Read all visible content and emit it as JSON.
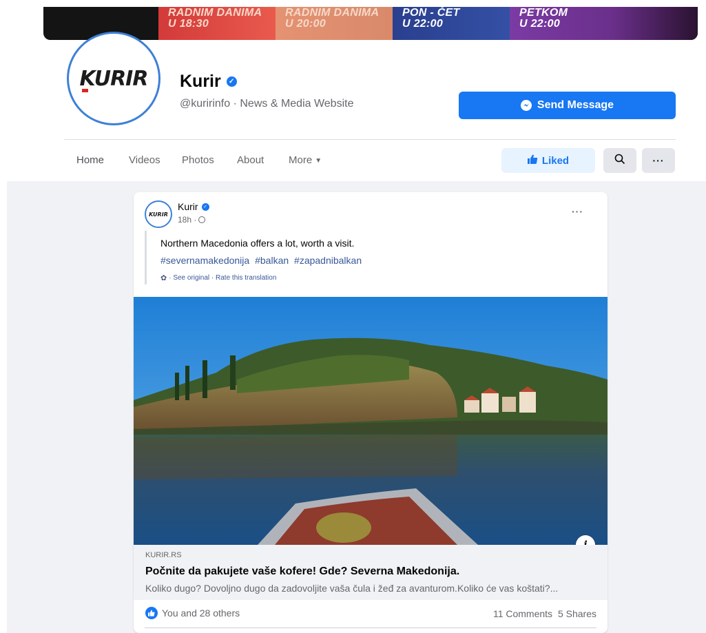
{
  "cover": {
    "segments": [
      {
        "line1": "RADNIM DANIMA",
        "line2": "U 18:30"
      },
      {
        "line1": "RADNIM DANIMA",
        "line2": "U 20:00"
      },
      {
        "line1": "PON - ČET",
        "line2": "U 22:00"
      },
      {
        "line1": "PETKOM",
        "line2": "U 22:00"
      }
    ]
  },
  "profile": {
    "avatar_logo": "KURIR",
    "name": "Kurir",
    "subtitle": "@kuririnfo · News & Media Website",
    "message_button": "Send Message"
  },
  "tabs": {
    "home": "Home",
    "videos": "Videos",
    "photos": "Photos",
    "about": "About",
    "more": "More",
    "liked": "Liked"
  },
  "post": {
    "avatar_logo": "KURIR",
    "author": "Kurir",
    "time": "18h ·",
    "text": "Northern Macedonia offers a lot, worth a visit.",
    "hashtags": [
      "#severnamakedonija",
      "#balkan",
      "#zapadnibalkan"
    ],
    "translation_meta": "· See original · Rate this translation",
    "link": {
      "domain": "KURIR.RS",
      "title": "Počnite da pakujete vaše kofere! Gde? Severna Makedonija.",
      "description": "Koliko dugo? Dovoljno dugo da zadovoljite vaša čula i žeđ za avanturom.Koliko će vas koštati?..."
    },
    "reactions": "You and 28 others",
    "comments": "11 Comments",
    "shares": "5 Shares"
  },
  "colors": {
    "brand_blue": "#1877f2",
    "liked_bg": "#e7f3ff",
    "feed_bg": "#f0f2f5"
  }
}
